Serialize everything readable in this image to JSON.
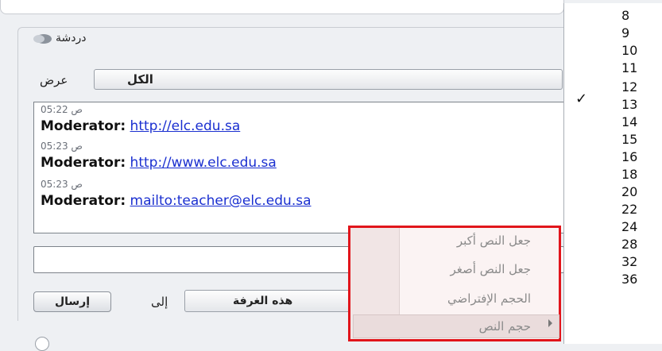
{
  "chat": {
    "title": "دردشة",
    "show_label": "عرض",
    "show_value": "الكل",
    "to_label": "إلى",
    "room_value": "هذه الغرفة",
    "send_label": "إرسال"
  },
  "messages": [
    {
      "time": "05:22 ص",
      "sender": "Moderator:",
      "link": "http://elc.edu.sa"
    },
    {
      "time": "05:23 ص",
      "sender": "Moderator:",
      "link": "http://www.elc.edu.sa"
    },
    {
      "time": "05:23 ص",
      "sender": "Moderator:",
      "link": "mailto:teacher@elc.edu.sa"
    }
  ],
  "context_menu": {
    "items": [
      "جعل النص أكبر",
      "جعل النص أصغر",
      "الحجم الإفتراضي",
      "حجم النص"
    ],
    "highlighted": "حجم النص"
  },
  "size_menu": {
    "sizes": [
      "8",
      "9",
      "10",
      "11",
      "12",
      "13",
      "14",
      "15",
      "16",
      "18",
      "20",
      "22",
      "24",
      "28",
      "32",
      "36"
    ],
    "checked": "12",
    "check_glyph": "✓"
  },
  "colors": {
    "accent_border": "#e1151b",
    "link": "#1a2fd0"
  }
}
